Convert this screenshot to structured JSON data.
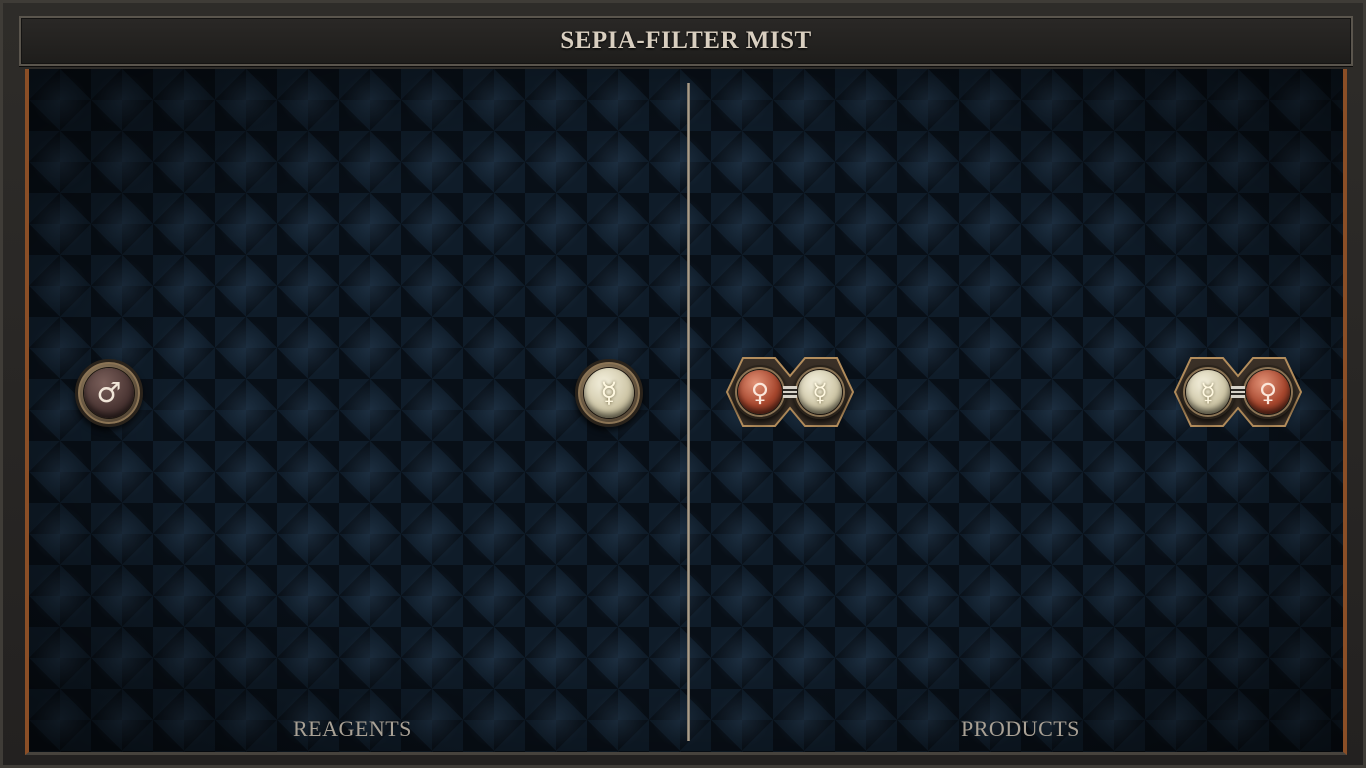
{
  "title": "SEPIA-FILTER MIST",
  "zones": {
    "reagents_label": "REAGENTS",
    "products_label": "PRODUCTS"
  },
  "reagents": [
    {
      "element": "iron",
      "symbol": "♂",
      "icon": "mars-iron-icon"
    },
    {
      "element": "quicksilver",
      "symbol": "☿",
      "icon": "mercury-quicksilver-icon"
    }
  ],
  "products": [
    {
      "atoms": [
        {
          "element": "copper",
          "symbol": "♀",
          "icon": "venus-copper-icon"
        },
        {
          "element": "quicksilver",
          "symbol": "☿",
          "icon": "mercury-quicksilver-icon"
        }
      ],
      "bond": "double"
    },
    {
      "atoms": [
        {
          "element": "quicksilver",
          "symbol": "☿",
          "icon": "mercury-quicksilver-icon"
        },
        {
          "element": "copper",
          "symbol": "♀",
          "icon": "venus-copper-icon"
        }
      ],
      "bond": "double"
    }
  ],
  "colors": {
    "frame_trim": "#8a4e26",
    "board_bg": "#0f1c29",
    "title_text": "#d9cfc0",
    "label_text": "#a9a195"
  }
}
